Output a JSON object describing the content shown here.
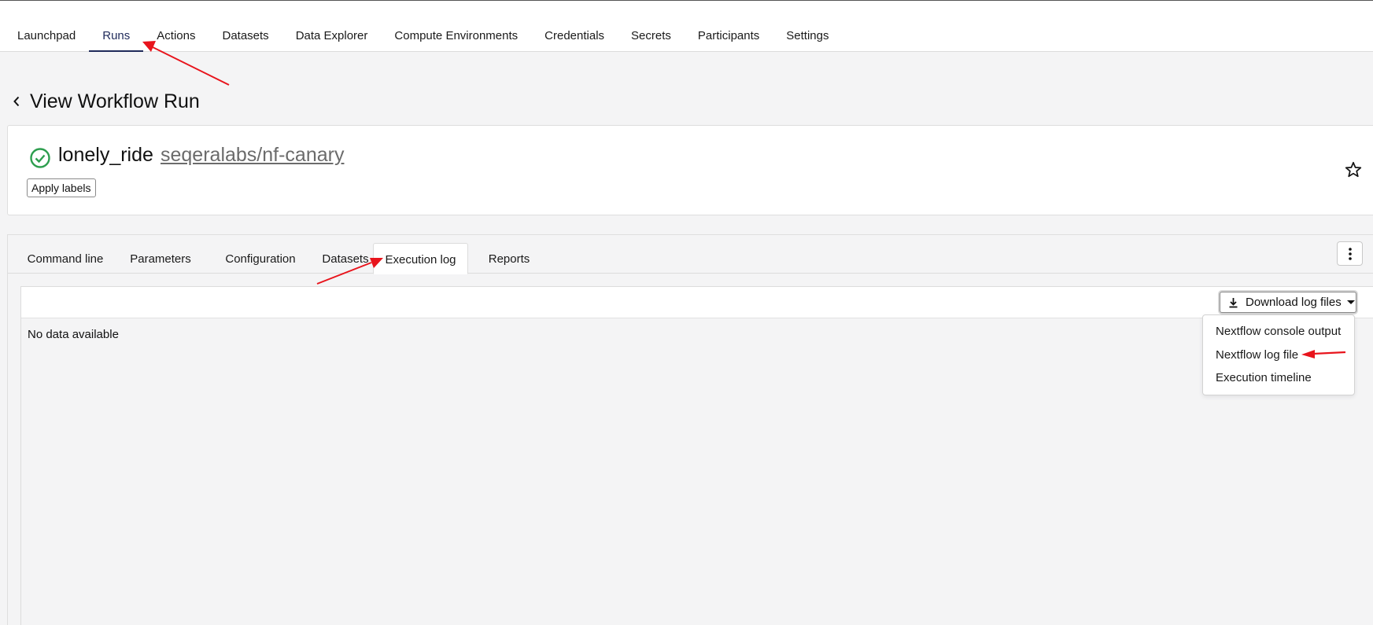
{
  "topnav": {
    "items": [
      {
        "label": "Launchpad",
        "active": false
      },
      {
        "label": "Runs",
        "active": true
      },
      {
        "label": "Actions",
        "active": false
      },
      {
        "label": "Datasets",
        "active": false
      },
      {
        "label": "Data Explorer",
        "active": false
      },
      {
        "label": "Compute Environments",
        "active": false
      },
      {
        "label": "Credentials",
        "active": false
      },
      {
        "label": "Secrets",
        "active": false
      },
      {
        "label": "Participants",
        "active": false
      },
      {
        "label": "Settings",
        "active": false
      }
    ]
  },
  "page": {
    "title": "View Workflow Run",
    "back_icon": "chevron-left-icon"
  },
  "run": {
    "name": "lonely_ride",
    "repo": "seqeralabs/nf-canary",
    "status": "succeeded",
    "status_icon": "check-circle-icon",
    "apply_labels": "Apply labels",
    "star_icon": "star-outline-icon"
  },
  "tabs": {
    "items": [
      {
        "label": "Command line",
        "active": false
      },
      {
        "label": "Parameters",
        "active": false
      },
      {
        "label": "Configuration",
        "active": false
      },
      {
        "label": "Datasets",
        "active": false
      },
      {
        "label": "Execution log",
        "active": true
      },
      {
        "label": "Reports",
        "active": false
      }
    ],
    "more_icon": "more-vertical-icon"
  },
  "log": {
    "empty_text": "No data available",
    "download": {
      "label": "Download log files",
      "icon": "download-icon",
      "options": [
        "Nextflow console output",
        "Nextflow log file",
        "Execution timeline"
      ]
    }
  },
  "colors": {
    "accent": "#1f2a5a",
    "success": "#2e9e4f",
    "annotation_arrow": "#e8141c"
  }
}
